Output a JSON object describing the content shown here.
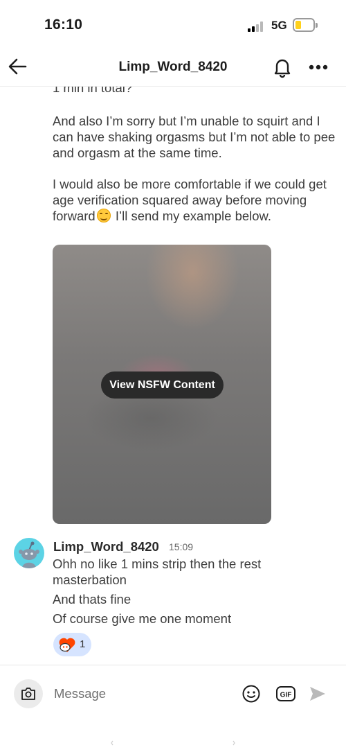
{
  "status_bar": {
    "time": "16:10",
    "network": "5G"
  },
  "header": {
    "title": "Limp_Word_8420"
  },
  "messages": {
    "cutoff_line": "1 min in total?",
    "paragraph_2": "And also I’m sorry but I’m unable to squirt and I can have shaking orgasms but I’m not able to pee and orgasm at the same time.",
    "paragraph_3_before_emoji": "I would also be more comfortable if we could get age verification squared away before moving forward",
    "paragraph_3_after_emoji": " I’ll send my example below.",
    "nsfw_button_label": "View NSFW Content",
    "reply": {
      "sender": "Limp_Word_8420",
      "time": "15:09",
      "lines": [
        "Ohh no like 1 mins strip then the rest masterbation",
        "And thats fine",
        "Of course give me one moment"
      ],
      "reaction": {
        "icon": "heart-snoo-icon",
        "count": "1"
      }
    }
  },
  "composer": {
    "placeholder": "Message",
    "gif_label": "GIF"
  },
  "colors": {
    "reaction_bg": "#d6e4ff",
    "avatar_bg": "#5cd3e5",
    "battery_fill": "#ffd11a"
  }
}
